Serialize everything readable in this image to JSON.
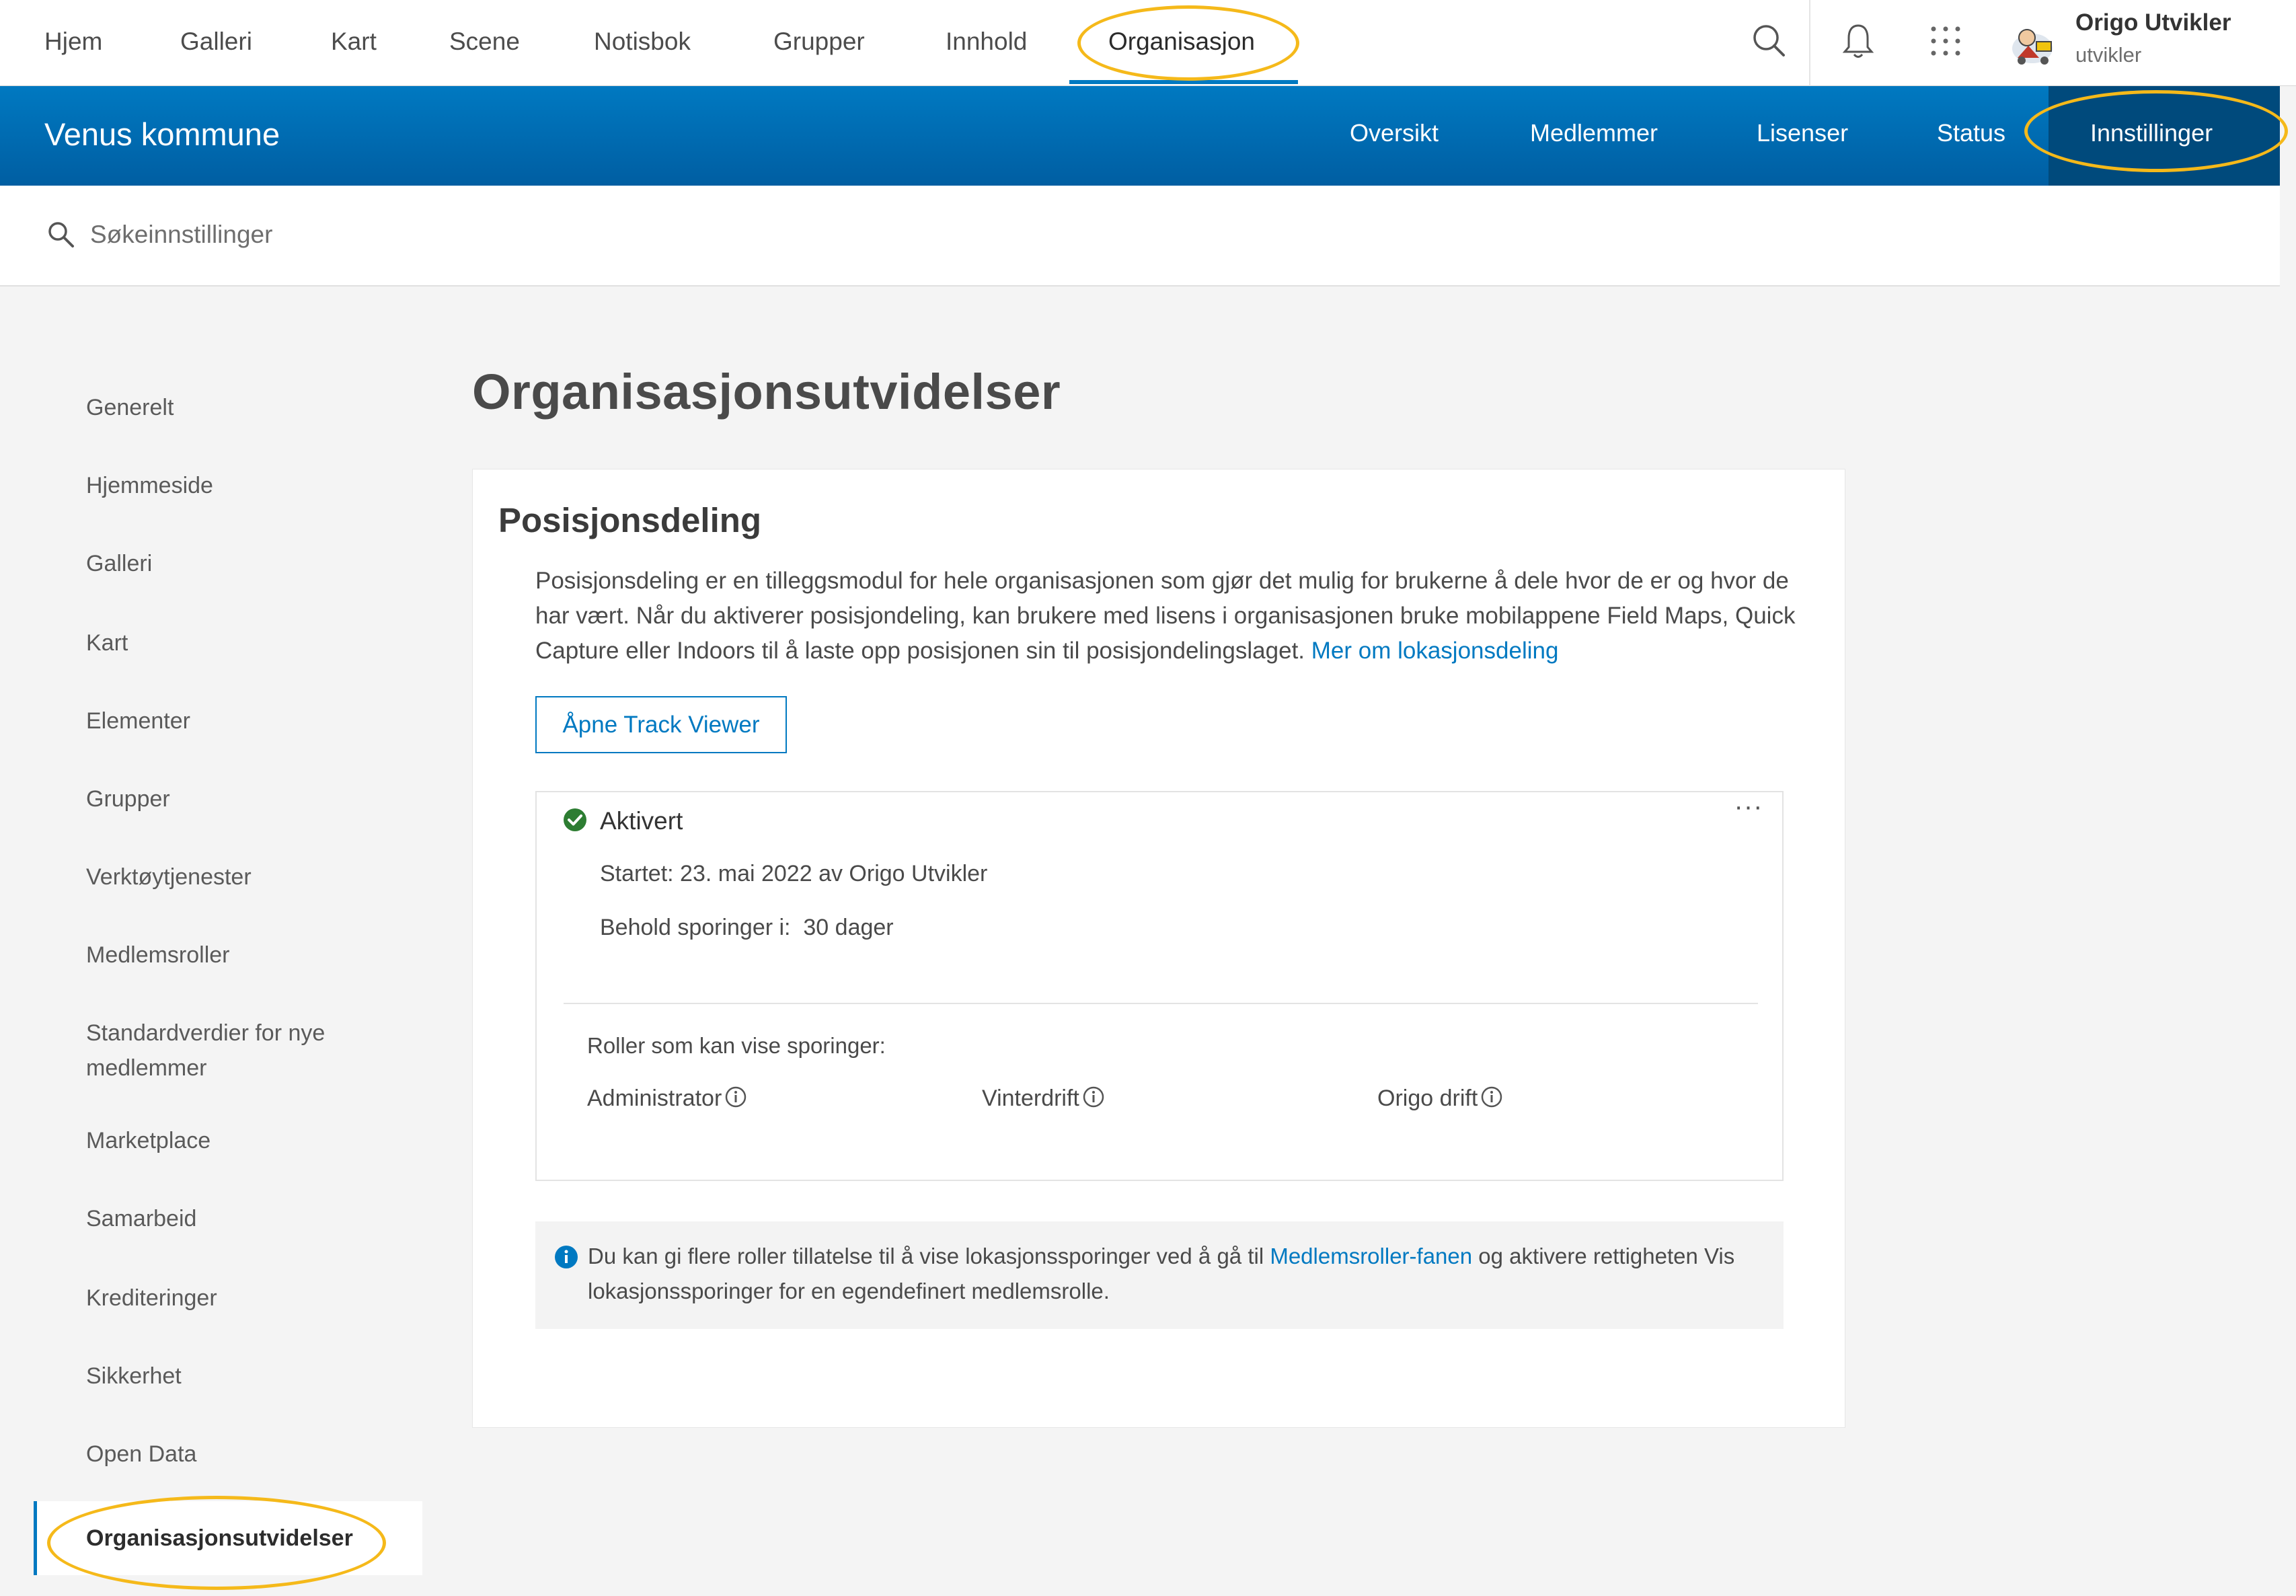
{
  "topnav": {
    "items": [
      "Hjem",
      "Galleri",
      "Kart",
      "Scene",
      "Notisbok",
      "Grupper",
      "Innhold",
      "Organisasjon"
    ],
    "icons": [
      "search-icon",
      "bell-icon",
      "app-launcher-icon"
    ],
    "user": {
      "name": "Origo Utvikler",
      "handle": "utvikler"
    }
  },
  "orgbar": {
    "title": "Venus kommune",
    "tabs": [
      "Oversikt",
      "Medlemmer",
      "Lisenser",
      "Status",
      "Innstillinger"
    ]
  },
  "search": {
    "placeholder": "Søkeinnstillinger"
  },
  "sidenav": {
    "items": [
      "Generelt",
      "Hjemmeside",
      "Galleri",
      "Kart",
      "Elementer",
      "Grupper",
      "Verktøytjenester",
      "Medlemsroller",
      "Standardverdier for nye medlemmer",
      "Marketplace",
      "Samarbeid",
      "Krediteringer",
      "Sikkerhet",
      "Open Data",
      "Organisasjonsutvidelser"
    ]
  },
  "main": {
    "title": "Organisasjonsutvidelser",
    "section": {
      "title": "Posisjonsdeling",
      "description": "Posisjonsdeling er en tilleggsmodul for hele organisasjonen som gjør det mulig for brukerne å dele hvor de er og hvor de har vært. Når du aktiverer posisjondeling, kan brukere med lisens i organisasjonen bruke mobilappene Field Maps, Quick Capture eller Indoors til å laste opp posisjonen sin til posisjondelingslaget.",
      "learn_more_link": "Mer om lokasjonsdeling",
      "open_button": "Åpne Track Viewer",
      "status": {
        "label": "Aktivert",
        "more": "···",
        "started": "Startet: 23. mai 2022 av Origo Utvikler",
        "retain": "Behold sporinger i:  30 dager",
        "roles_label": "Roller som kan vise sporinger:",
        "roles": [
          "Administrator",
          "Vinterdrift",
          "Origo drift"
        ]
      },
      "info": {
        "text_before": "Du kan gi flere roller tillatelse til å vise lokasjonssporinger ved å gå til ",
        "link": "Medlemsroller-fanen",
        "text_after": " og aktivere rettigheten Vis lokasjonssporinger for en egendefinert medlemsrolle."
      }
    }
  },
  "colors": {
    "accent": "#0079c1",
    "highlight": "#f5b91a",
    "success": "#35ac46"
  }
}
